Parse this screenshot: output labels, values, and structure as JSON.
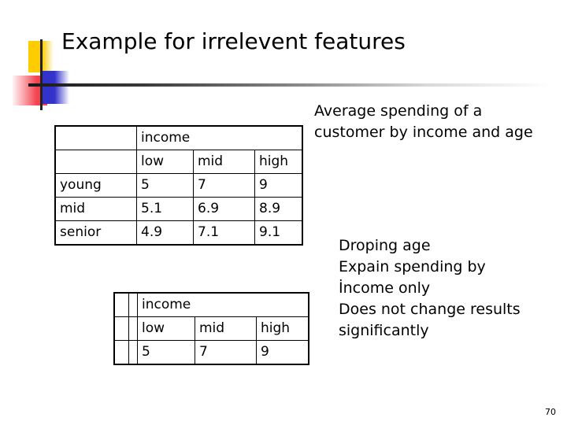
{
  "slide": {
    "title": "Example for irrelevent features",
    "page_number": "70",
    "background_color": "#ffffff",
    "text_color": "#000000"
  },
  "logo": {
    "yellow": "#FFCC00",
    "blue": "#3333CC",
    "red": "#F4424F",
    "line": "#222222"
  },
  "table_age_income": {
    "rows": [
      {
        "label": "",
        "low": "income",
        "mid": "",
        "high": ""
      },
      {
        "label": "",
        "low": "low",
        "mid": "mid",
        "high": "high"
      },
      {
        "label": "young",
        "low": "5",
        "mid": "7",
        "high": "9"
      },
      {
        "label": "mid",
        "low": "5.1",
        "mid": "6.9",
        "high": "8.9"
      },
      {
        "label": "senior",
        "low": "4.9",
        "mid": "7.1",
        "high": "9.1"
      }
    ]
  },
  "table_income_only": {
    "rows": [
      {
        "pad1": "",
        "pad2": "",
        "low": "income",
        "mid": "",
        "high": ""
      },
      {
        "pad1": "",
        "pad2": "",
        "low": "low",
        "mid": "mid",
        "high": "high"
      },
      {
        "pad1": "",
        "pad2": "",
        "low": "5",
        "mid": "7",
        "high": "9"
      }
    ]
  },
  "caption": {
    "text": "Average spending of a customer by income and age"
  },
  "notes": {
    "lines": [
      "Droping age",
      "Expain spending by",
      "İncome only",
      "Does not change results",
      "significantly"
    ]
  }
}
